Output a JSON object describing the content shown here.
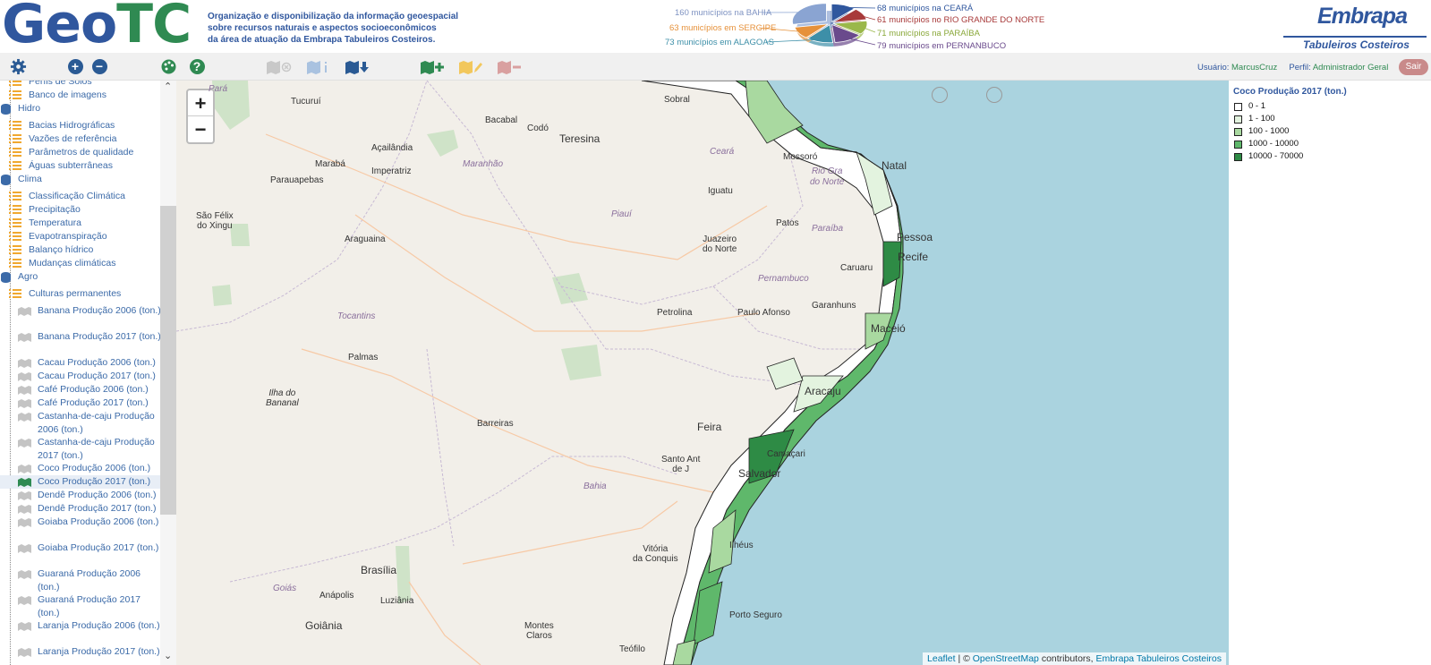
{
  "header": {
    "logo_geo": "Geo",
    "logo_tc": "TC",
    "tagline_1": "Organização e disponibilização da informação geoespacial",
    "tagline_2": "sobre recursos naturais e aspectos socioeconômicos",
    "tagline_3": "da área de atuação da Embrapa Tabuleiros Costeiros.",
    "embrapa": "Embrapa",
    "embrapa_sub": "Tabuleiros Costeiros"
  },
  "chart_data": {
    "type": "pie",
    "categories": [
      "BAHIA",
      "SERGIPE",
      "ALAGOAS",
      "PERNANBUCO",
      "PARAÍBA",
      "RIO GRANDE DO NORTE",
      "CEARÁ"
    ],
    "values": [
      160,
      63,
      73,
      79,
      71,
      61,
      68
    ],
    "labels": [
      "160 municípios na BAHIA",
      "63 municípios em SERGIPE",
      "73 municípios em ALAGOAS",
      "79 municípios em PERNANBUCO",
      "71 municípios na PARAÍBA",
      "61 municípios no RIO GRANDE DO NORTE",
      "68 municípios na CEARÁ"
    ],
    "colors": [
      "#8aa4d2",
      "#e6913a",
      "#3d8fa8",
      "#6a4a8c",
      "#9ab84a",
      "#a83a3a",
      "#30579e"
    ]
  },
  "toolbar": {
    "user_label": "Usuário:",
    "user_value": "MarcusCruz",
    "profile_label": "Perfil:",
    "profile_value": "Administrador Geral",
    "exit_label": "Sair"
  },
  "tree": {
    "solos_items": [
      "Perfis de Solos",
      "Banco de imagens"
    ],
    "hidro": "Hidro",
    "hidro_items": [
      "Bacias Hidrográficas",
      "Vazões de referência",
      "Parâmetros de qualidade",
      "Águas subterrâneas"
    ],
    "clima": "Clima",
    "clima_items": [
      "Classificação Climática",
      "Precipitação",
      "Temperatura",
      "Evapotranspiração",
      "Balanço hídrico",
      "Mudanças climáticas"
    ],
    "agro": "Agro",
    "culturas": "Culturas permanentes",
    "layers": [
      "Banana Produção 2006 (ton.)",
      "Banana Produção 2017 (ton.)",
      "Cacau Produção 2006 (ton.)",
      "Cacau Produção 2017 (ton.)",
      "Café Produção 2006 (ton.)",
      "Café Produção 2017 (ton.)",
      "Castanha-de-caju Produção 2006 (ton.)",
      "Castanha-de-caju Produção 2017 (ton.)",
      "Coco Produção 2006 (ton.)",
      "Coco Produção 2017 (ton.)",
      "Dendê Produção 2006 (ton.)",
      "Dendê Produção 2017 (ton.)",
      "Goiaba Produção 2006 (ton.)",
      "Goiaba Produção 2017 (ton.)",
      "Guaraná Produção 2006 (ton.)",
      "Guaraná Produção 2017 (ton.)",
      "Laranja Produção 2006 (ton.)",
      "Laranja Produção 2017 (ton.)"
    ]
  },
  "map": {
    "zoom_in": "+",
    "zoom_out": "−",
    "cities": [
      "Sobral",
      "Tucuruí",
      "Bacabal",
      "Codó",
      "Teresina",
      "Açailândia",
      "Marabá",
      "Imperatriz",
      "Parauapebas",
      "São Félix do Xingu",
      "Araguaina",
      "Iguatu",
      "Mossoró",
      "Natal",
      "Patos",
      "Juazeiro do Norte",
      "Pessoa",
      "Recife",
      "Caruaru",
      "Petrolina",
      "Paulo Afonso",
      "Garanhuns",
      "Maceió",
      "Palmas",
      "Ilha do Bananal",
      "Aracaju",
      "Barreiras",
      "Feira",
      "Camaçari",
      "Santo Antônio de Jesus",
      "Salvador",
      "Vitória da Conquista",
      "Ilhéus",
      "Brasília",
      "Anápolis",
      "Luziânia",
      "Goiânia",
      "Montes Claros",
      "Porto Seguro",
      "Teófilo"
    ],
    "states": [
      "Pará",
      "Maranhão",
      "Ceará",
      "Rio Grande do Norte",
      "Piauí",
      "Paraíba",
      "Pernambuco",
      "Tocantins",
      "Bahia",
      "Goiás"
    ],
    "attr_leaflet": "Leaflet",
    "attr_sep": " | © ",
    "attr_osm": "OpenStreetMap",
    "attr_contrib": " contributors, ",
    "attr_embrapa": "Embrapa Tabuleiros Costeiros"
  },
  "legend": {
    "title": "Coco Produção 2017 (ton.)",
    "classes": [
      {
        "label": "0 - 1",
        "color": "#ffffff"
      },
      {
        "label": "1 - 100",
        "color": "#e3f3df"
      },
      {
        "label": "100 - 1000",
        "color": "#a9d9a0"
      },
      {
        "label": "1000 - 10000",
        "color": "#5fb86b"
      },
      {
        "label": "10000 - 70000",
        "color": "#2e8b45"
      }
    ]
  }
}
